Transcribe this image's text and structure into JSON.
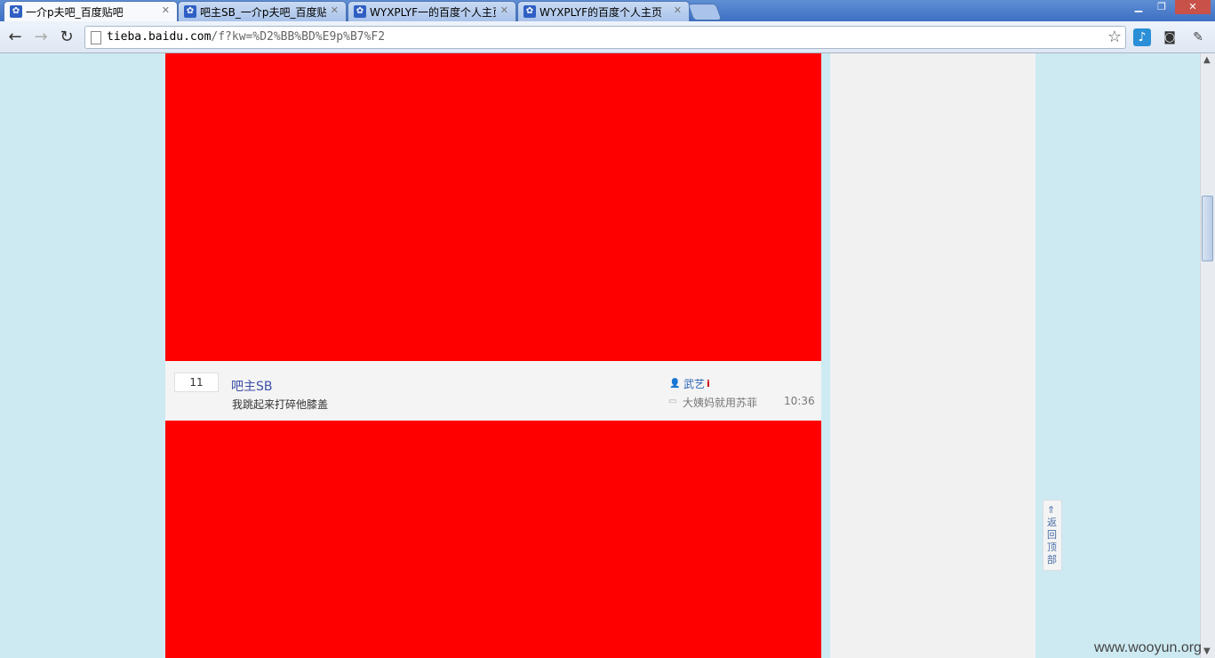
{
  "browser": {
    "tabs": [
      {
        "title": "一介p夫吧_百度贴吧",
        "active": true
      },
      {
        "title": "吧主SB_一介p夫吧_百度贴吧",
        "active": false
      },
      {
        "title": "WYXPLYF一的百度个人主页",
        "active": false
      },
      {
        "title": "WYXPLYF的百度个人主页",
        "active": false
      }
    ],
    "url_host": "tieba.baidu.com",
    "url_path": "/f?kw=%D2%BB%BD%E9p%B7%F2",
    "window_controls": {
      "minimize": "▁",
      "maximize": "❐",
      "close": "✕"
    },
    "icons": [
      "back-icon",
      "forward-icon",
      "reload-icon",
      "page-icon",
      "star-icon",
      "extension-icon",
      "camera-icon",
      "wrench-icon"
    ]
  },
  "thread": {
    "reply_count": "11",
    "title": "吧主SB",
    "abstract": "我跳起来打碎他膝盖",
    "author": "武艺",
    "last_replier": "大姨妈就用苏菲",
    "time": "10:36"
  },
  "back_to_top": {
    "label": "返回顶部"
  },
  "watermark": "www.wooyun.org",
  "colors": {
    "injected_block": "#ff0000",
    "page_bg": "#cdeaf2",
    "link": "#3d4ea8"
  }
}
